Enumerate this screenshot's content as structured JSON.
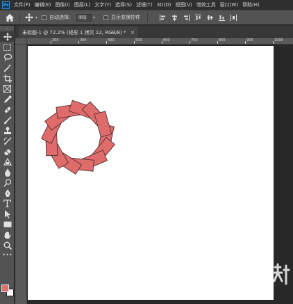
{
  "app": {
    "logo": "Ps"
  },
  "menu": [
    "文件(F)",
    "编辑(E)",
    "图像(I)",
    "图层(L)",
    "文字(Y)",
    "选择(S)",
    "滤镜(T)",
    "3D(D)",
    "视图(V)",
    "增效工具",
    "窗口(W)",
    "帮助(H)"
  ],
  "options": {
    "auto_select_label": "自动选择：",
    "auto_select_value": "图层",
    "show_transform_label": "显示变换控件"
  },
  "document": {
    "tab_title": "未标题-1 @ 72.2% (矩形 1 拷贝 12, RGB/8) *",
    "close_glyph": "×"
  },
  "ruler": {
    "top_labels": [
      "200",
      "300",
      "400",
      "500",
      "600",
      "700",
      "800",
      "900",
      "1000"
    ],
    "unit": "px"
  },
  "tools": [
    "move-tool",
    "marquee-tool",
    "lasso-tool",
    "magic-wand-tool",
    "crop-tool",
    "frame-tool",
    "eyedropper-tool",
    "healing-brush-tool",
    "brush-tool",
    "clone-stamp-tool",
    "history-brush-tool",
    "eraser-tool",
    "gradient-tool",
    "blur-tool",
    "dodge-tool",
    "pen-tool",
    "type-tool",
    "path-selection-tool",
    "rectangle-tool",
    "hand-tool",
    "zoom-tool"
  ],
  "colors": {
    "foreground": "#e07070",
    "background": "#ffffff",
    "shape_fill": "#e06b6b",
    "shape_stroke": "#3a2a2a"
  },
  "artwork": {
    "shape": "rectangle",
    "copies": 13,
    "arrangement": "rotated ring"
  }
}
